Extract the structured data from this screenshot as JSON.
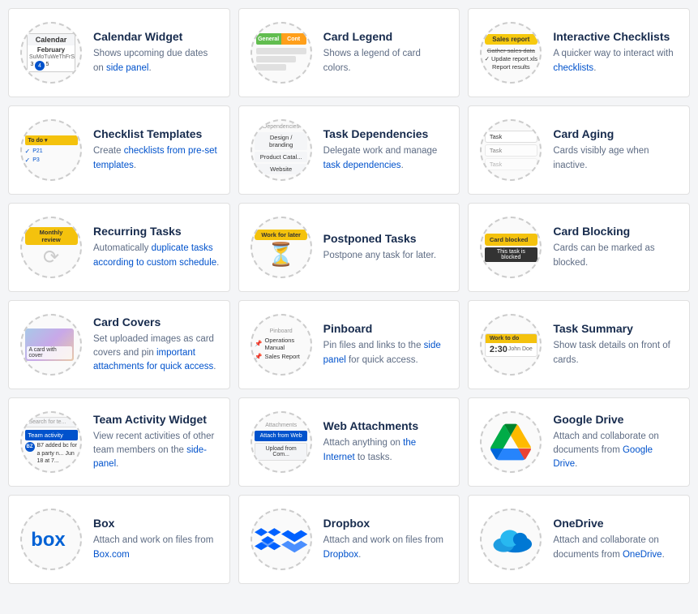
{
  "cards": [
    {
      "id": "calendar-widget",
      "title": "Calendar Widget",
      "desc": "Shows upcoming due dates on side panel.",
      "desc_links": [
        "side panel"
      ]
    },
    {
      "id": "card-legend",
      "title": "Card Legend",
      "desc": "Shows a legend of card colors."
    },
    {
      "id": "interactive-checklists",
      "title": "Interactive Checklists",
      "desc": "A quicker way to interact with checklists.",
      "desc_links": [
        "checklists"
      ]
    },
    {
      "id": "checklist-templates",
      "title": "Checklist Templates",
      "desc": "Create checklists from pre-set templates.",
      "desc_links": [
        "checklists from pre-set templates"
      ]
    },
    {
      "id": "task-dependencies",
      "title": "Task Dependencies",
      "desc": "Delegate work and manage task dependencies.",
      "desc_links": [
        "task dependencies"
      ]
    },
    {
      "id": "card-aging",
      "title": "Card Aging",
      "desc": "Cards visibly age when inactive."
    },
    {
      "id": "recurring-tasks",
      "title": "Recurring Tasks",
      "desc": "Automatically duplicate tasks according to custom schedule.",
      "desc_links": [
        "duplicate tasks according to custom schedule"
      ]
    },
    {
      "id": "postponed-tasks",
      "title": "Postponed Tasks",
      "desc": "Postpone any task for later."
    },
    {
      "id": "card-blocking",
      "title": "Card Blocking",
      "desc": "Cards can be marked as blocked."
    },
    {
      "id": "card-covers",
      "title": "Card Covers",
      "desc": "Set uploaded images as card covers and pin important attachments for quick access.",
      "desc_links": [
        "important attachments for quick access"
      ]
    },
    {
      "id": "pinboard",
      "title": "Pinboard",
      "desc": "Pin files and links to the side panel for quick access.",
      "desc_links": [
        "side panel"
      ]
    },
    {
      "id": "task-summary",
      "title": "Task Summary",
      "desc": "Show task details on front of cards."
    },
    {
      "id": "team-activity-widget",
      "title": "Team Activity Widget",
      "desc": "View recent activities of other team members on the side-panel.",
      "desc_links": [
        "side-panel"
      ]
    },
    {
      "id": "web-attachments",
      "title": "Web Attachments",
      "desc": "Attach anything on the Internet to tasks.",
      "desc_links": [
        "the Internet"
      ]
    },
    {
      "id": "google-drive",
      "title": "Google Drive",
      "desc": "Attach and collaborate on documents from Google Drive.",
      "desc_links": [
        "Google Drive"
      ]
    },
    {
      "id": "box",
      "title": "Box",
      "desc": "Attach and work on files from Box.com",
      "desc_links": [
        "Box.com"
      ]
    },
    {
      "id": "dropbox",
      "title": "Dropbox",
      "desc": "Attach and work on files from Dropbox.",
      "desc_links": [
        "Dropbox"
      ]
    },
    {
      "id": "onedrive",
      "title": "OneDrive",
      "desc": "Attach and collaborate on documents from OneDrive.",
      "desc_links": [
        "OneDrive"
      ]
    }
  ]
}
